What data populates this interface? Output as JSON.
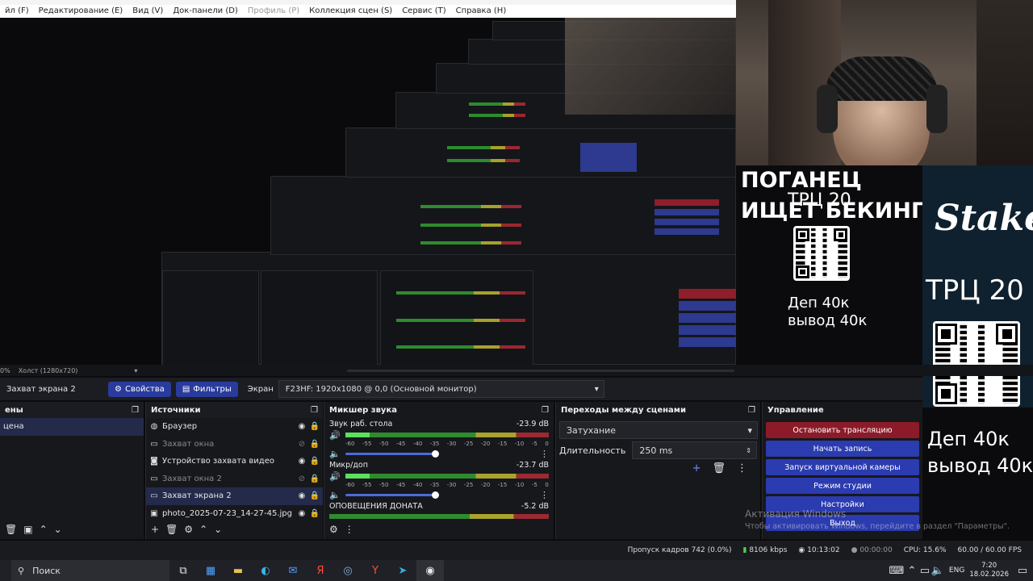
{
  "menu": {
    "items": [
      {
        "label": "йл (F)",
        "dim": false
      },
      {
        "label": "Редактирование (E)",
        "dim": false
      },
      {
        "label": "Вид (V)",
        "dim": false
      },
      {
        "label": "Док-панели (D)",
        "dim": false
      },
      {
        "label": "Профиль (P)",
        "dim": true
      },
      {
        "label": "Коллекция сцен (S)",
        "dim": false
      },
      {
        "label": "Сервис (T)",
        "dim": false
      },
      {
        "label": "Справка (H)",
        "dim": false
      }
    ]
  },
  "overlay": {
    "title_line1": "ПОГАНЕЦ",
    "title_line2": "ИЩЕТ БЕКИНГ",
    "trc_small": "ТРЦ 20",
    "dep_line1": "Деп 40к",
    "dep_line2": "вывод 40к",
    "stake_logo": "Stake",
    "trc_right": "ТРЦ 20",
    "dep_bottom_1": "Деп 40к",
    "dep_bottom_2": "вывод 40к"
  },
  "canvas_bar": {
    "zoom_label": "0%",
    "canvas_label": "Холст (1280x720)"
  },
  "properties_bar": {
    "source_name": "Захват экрана 2",
    "properties_label": "Свойства",
    "filters_label": "Фильтры",
    "screen_label": "Экран",
    "screen_value": "F23HF: 1920x1080 @ 0,0 (Основной монитор)"
  },
  "scenes": {
    "title": "ены",
    "items": [
      {
        "label": "цена"
      }
    ]
  },
  "sources": {
    "title": "Источники",
    "items": [
      {
        "label": "Браузер",
        "icon": "globe-icon",
        "dim": false,
        "visible": true
      },
      {
        "label": "Захват окна",
        "icon": "window-icon",
        "dim": true,
        "visible": false
      },
      {
        "label": "Устройство захвата видео",
        "icon": "camera-icon",
        "dim": false,
        "visible": true
      },
      {
        "label": "Захват окна 2",
        "icon": "window-icon",
        "dim": true,
        "visible": false
      },
      {
        "label": "Захват экрана 2",
        "icon": "monitor-icon",
        "dim": false,
        "visible": true
      },
      {
        "label": "photo_2025-07-23_14-27-45.jpg",
        "icon": "image-icon",
        "dim": false,
        "visible": true
      }
    ]
  },
  "mixer": {
    "title": "Микшер звука",
    "ticks": [
      "-60",
      "-55",
      "-50",
      "-45",
      "-40",
      "-35",
      "-30",
      "-25",
      "-20",
      "-15",
      "-10",
      "-5",
      "0"
    ],
    "channels": [
      {
        "name": "Звук раб. стола",
        "db": "-23.9 dB",
        "volume": 0.8
      },
      {
        "name": "Микр/доп",
        "db": "-23.7 dB",
        "volume": 0.8
      },
      {
        "name": "ОПОВЕЩЕНИЯ ДОНАТА",
        "db": "-5.2 dB",
        "volume": 0.8
      }
    ]
  },
  "transitions": {
    "title": "Переходы между сценами",
    "selected": "Затухание",
    "duration_label": "Длительность",
    "duration_value": "250 ms"
  },
  "controls": {
    "title": "Управление",
    "buttons": [
      {
        "label": "Остановить трансляцию",
        "style": "red"
      },
      {
        "label": "Начать запись",
        "style": "blue"
      },
      {
        "label": "Запуск виртуальной камеры",
        "style": "blue"
      },
      {
        "label": "Режим студии",
        "style": "blue"
      },
      {
        "label": "Настройки",
        "style": "blue"
      },
      {
        "label": "Выход",
        "style": "blue"
      }
    ]
  },
  "watermark": {
    "line1": "Активация Windows",
    "line2": "Чтобы активировать Windows, перейдите в раздел \"Параметры\"."
  },
  "status": {
    "dropped": "Пропуск кадров 742 (0.0%)",
    "bitrate": "8106 kbps",
    "live_time": "10:13:02",
    "rec_time": "00:00:00",
    "cpu": "CPU: 15.6%",
    "fps": "60.00 / 60.00 FPS"
  },
  "taskbar": {
    "search_placeholder": "Поиск",
    "lang": "ENG",
    "time": "7:20",
    "date": "18.02.2026"
  },
  "colors": {
    "accent_blue": "#2b3bb0",
    "stream_red": "#8c1b29",
    "panel_bg": "#17181c"
  }
}
